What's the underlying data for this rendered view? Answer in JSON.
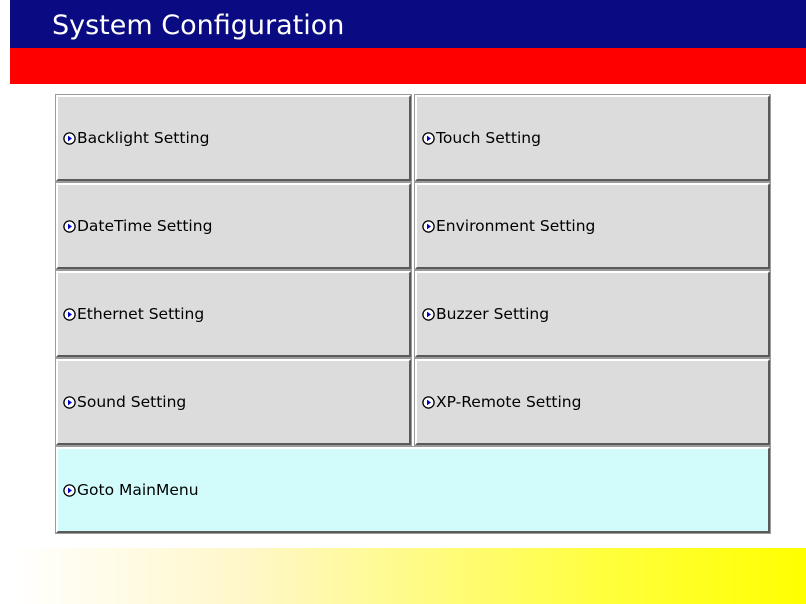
{
  "header": {
    "title": "System Configuration"
  },
  "colors": {
    "title_bar": "#0a0a82",
    "title_text": "#ffffff",
    "accent_band": "#ff0000",
    "button_face": "#dcdcdc",
    "main_menu_button_face": "#d2fcfc",
    "bottom_gradient_end": "#ffff00"
  },
  "menu": {
    "icon": "circle-arrow-right-icon",
    "items": [
      {
        "label": "Backlight Setting"
      },
      {
        "label": "Touch Setting"
      },
      {
        "label": "DateTime Setting"
      },
      {
        "label": "Environment Setting"
      },
      {
        "label": "Ethernet Setting"
      },
      {
        "label": "Buzzer Setting"
      },
      {
        "label": "Sound Setting"
      },
      {
        "label": "XP-Remote Setting"
      }
    ],
    "main_menu": {
      "label": "Goto MainMenu"
    }
  }
}
